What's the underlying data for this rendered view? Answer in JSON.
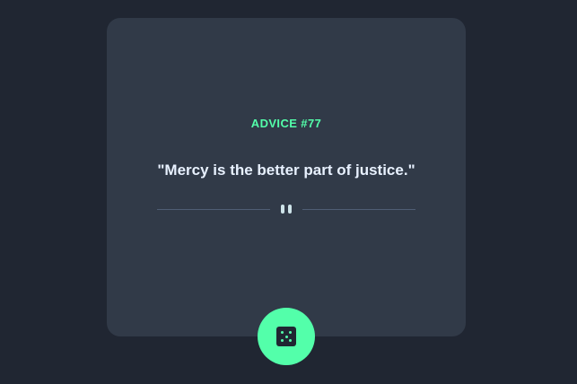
{
  "card": {
    "advice_label": "ADVICE #77",
    "quote": "\"Mercy is the better part of justice.\""
  },
  "divider": {
    "icon": "pause-icon"
  },
  "dice_button": {
    "icon": "dice-icon"
  },
  "colors": {
    "background": "#202632",
    "card": "#313a48",
    "accent": "#53ffaa",
    "quote_text": "#e8f1ff",
    "divider_line": "#4f5d74"
  }
}
